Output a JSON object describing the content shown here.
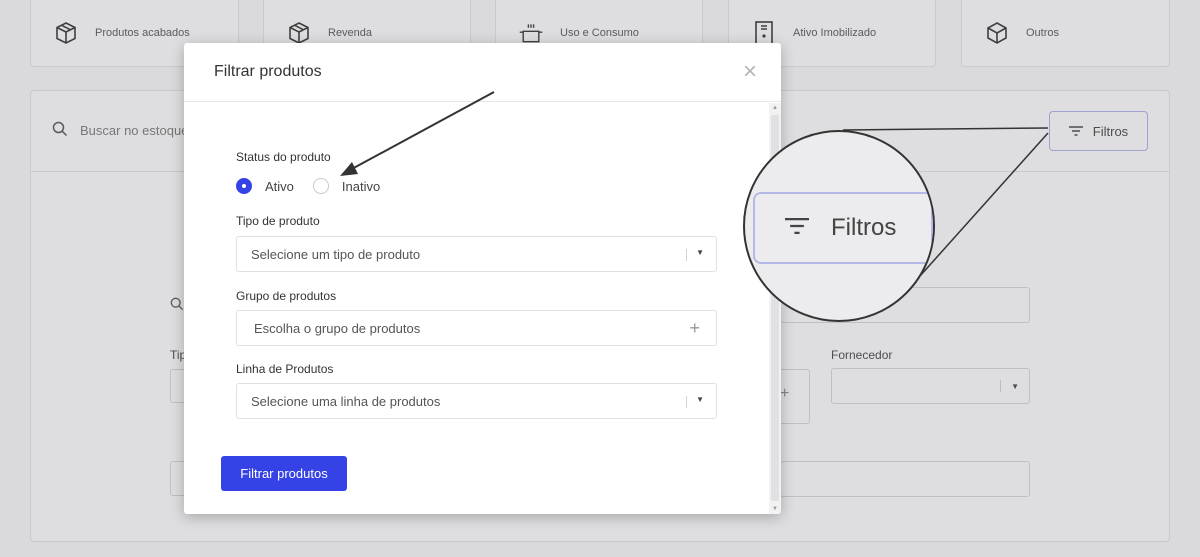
{
  "categories": [
    {
      "label": "Produtos acabados",
      "icon": "box-icon"
    },
    {
      "label": "Revenda",
      "icon": "box-icon"
    },
    {
      "label": "Uso e Consumo",
      "icon": "pot-icon"
    },
    {
      "label": "Ativo Imobilizado",
      "icon": "cabinet-icon"
    },
    {
      "label": "Outros",
      "icon": "cube-icon"
    }
  ],
  "search": {
    "placeholder": "Buscar no estoque"
  },
  "toolbar": {
    "filtros_label": "Filtros"
  },
  "background_form": {
    "fornecedor_label": "Fornecedor",
    "tipo_label_partial": "Tip"
  },
  "modal": {
    "title": "Filtrar produtos",
    "status_label": "Status do produto",
    "status_options": [
      "Ativo",
      "Inativo"
    ],
    "status_selected": "Ativo",
    "tipo_label": "Tipo de produto",
    "tipo_placeholder": "Selecione um tipo de produto",
    "grupo_label": "Grupo de produtos",
    "grupo_placeholder": "Escolha o grupo de produtos",
    "linha_label": "Linha de Produtos",
    "linha_placeholder": "Selecione uma linha de produtos",
    "submit_label": "Filtrar produtos"
  },
  "magnifier": {
    "label": "Filtros"
  },
  "colors": {
    "accent": "#3542e6",
    "highlight_border": "#a9abe0"
  }
}
